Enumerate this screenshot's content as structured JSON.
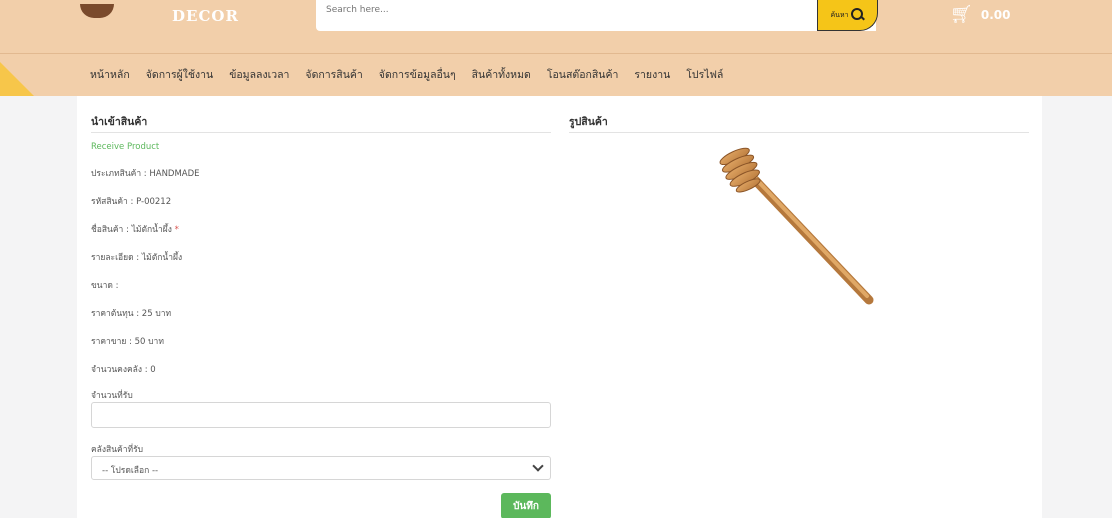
{
  "header": {
    "brand": "DECOR",
    "search": {
      "placeholder": "Search here...",
      "button_label": "ค้นหา"
    },
    "cart": {
      "total": "0.00"
    }
  },
  "nav": {
    "items": [
      {
        "label": "หน้าหลัก"
      },
      {
        "label": "จัดการผู้ใช้งาน"
      },
      {
        "label": "ข้อมูลลงเวลา"
      },
      {
        "label": "จัดการสินค้า"
      },
      {
        "label": "จัดการข้อมูลอื่นๆ"
      },
      {
        "label": "สินค้าทั้งหมด"
      },
      {
        "label": "โอนสต๊อกสินค้า"
      },
      {
        "label": "รายงาน"
      },
      {
        "label": "โปรไฟล์"
      }
    ]
  },
  "form": {
    "title": "นำเข้าสินค้า",
    "subtitle": "Receive Product",
    "fields": {
      "type": "ประเภทสินค้า : HANDMADE",
      "code": "รหัสสินค้า : P-00212",
      "name": "ชื่อสินค้า : ไม้ตักน้ำผึ้ง",
      "required_mark": "*",
      "detail": "รายละเอียด : ไม้ตักน้ำผึ้ง",
      "size": "ขนาด :",
      "cost": "ราคาต้นทุน : 25 บาท",
      "price": "ราคาขาย : 50 บาท",
      "stock": "จำนวนคงคลัง : 0"
    },
    "qty_label": "จำนวนที่รับ",
    "qty_value": "",
    "warehouse_label": "คลังสินค้าที่รับ",
    "warehouse_selected": "-- โปรดเลือก --",
    "save_label": "บันทึก"
  },
  "image_panel": {
    "title": "รูปสินค้า",
    "image_icon": "honey-dipper"
  },
  "colors": {
    "header": "#f2cfaa",
    "accent": "#f5c518",
    "success": "#5cb85c",
    "required": "#d9534f"
  }
}
